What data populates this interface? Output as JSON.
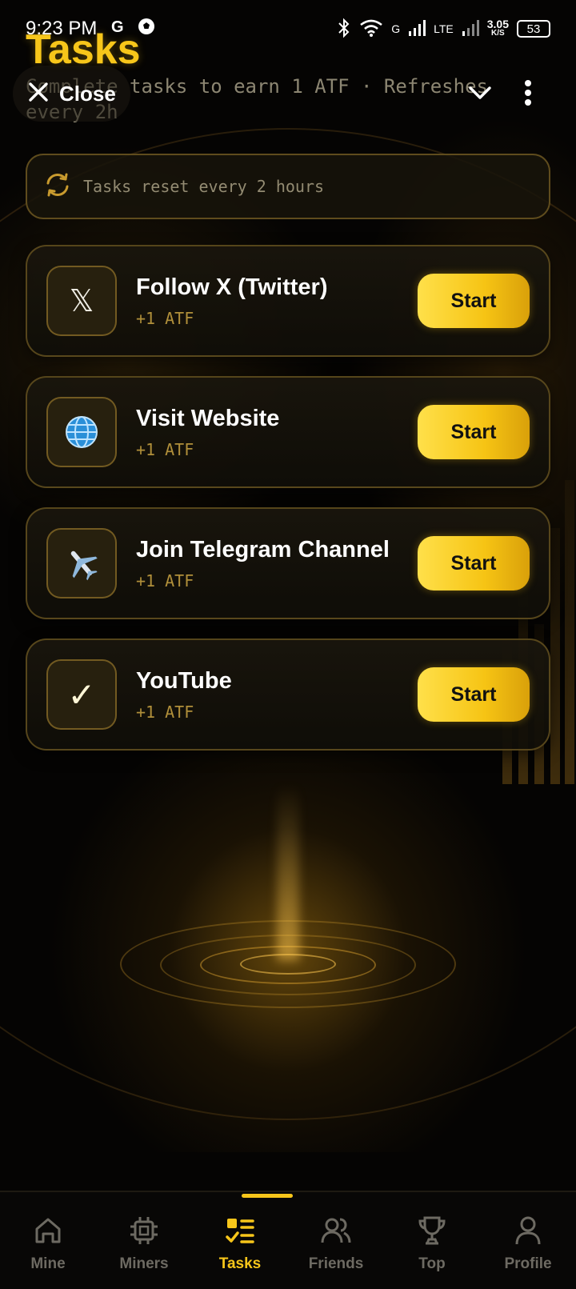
{
  "status_bar": {
    "time": "9:23 PM",
    "network_g": "G",
    "network_lte": "LTE",
    "speed_value": "3.05",
    "speed_unit": "K/S",
    "battery": "53"
  },
  "header": {
    "title": "Tasks",
    "subtitle": "Complete tasks to earn 1 ATF · Refreshes every 2h",
    "close_label": "Close"
  },
  "banner": {
    "text": "Tasks reset every 2 hours",
    "icon": "refresh-icon"
  },
  "tasks": [
    {
      "name": "Follow X (Twitter)",
      "reward": "+1 ATF",
      "icon": "x-logo-icon",
      "glyph": "𝕏",
      "button": "Start"
    },
    {
      "name": "Visit Website",
      "reward": "+1 ATF",
      "icon": "globe-icon",
      "glyph": "🌐",
      "button": "Start"
    },
    {
      "name": "Join Telegram Channel",
      "reward": "+1 ATF",
      "icon": "airplane-icon",
      "glyph": "✈️",
      "button": "Start"
    },
    {
      "name": "YouTube",
      "reward": "+1 ATF",
      "icon": "checkmark-icon",
      "glyph": "✓",
      "button": "Start"
    }
  ],
  "nav": {
    "items": [
      {
        "label": "Mine",
        "icon": "home-icon"
      },
      {
        "label": "Miners",
        "icon": "chip-icon"
      },
      {
        "label": "Tasks",
        "icon": "task-list-icon",
        "active": true
      },
      {
        "label": "Friends",
        "icon": "users-icon"
      },
      {
        "label": "Top",
        "icon": "trophy-icon"
      },
      {
        "label": "Profile",
        "icon": "user-icon"
      }
    ]
  },
  "colors": {
    "accent": "#f7c61a",
    "background": "#050403",
    "card_border": "#6e5822",
    "muted_text": "#8c8672"
  }
}
